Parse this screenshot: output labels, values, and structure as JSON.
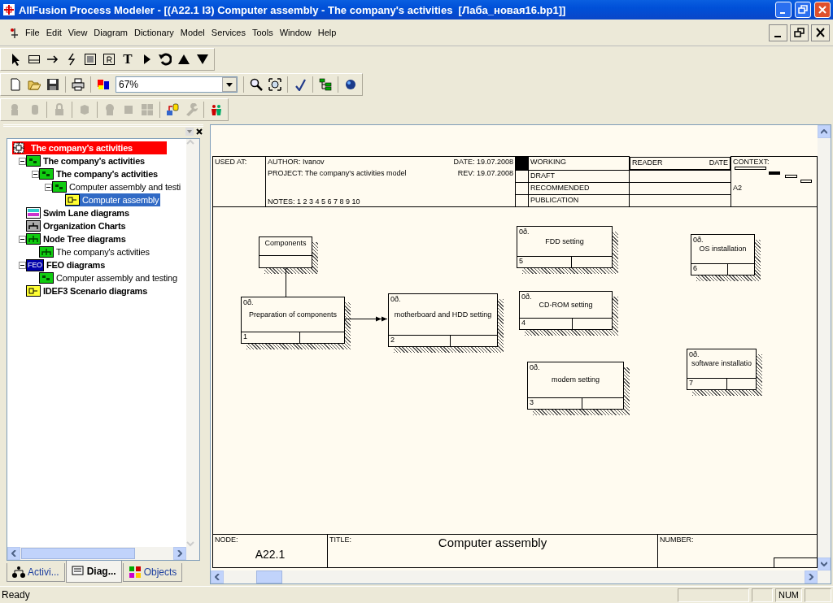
{
  "window": {
    "title": "AllFusion Process Modeler - [(A22.1 I3) Computer assembly - The company's activities  [Лаба_новая16.bp1]]"
  },
  "menu": [
    "File",
    "Edit",
    "View",
    "Diagram",
    "Dictionary",
    "Model",
    "Services",
    "Tools",
    "Window",
    "Help"
  ],
  "toolbar": {
    "text_tool": "T",
    "zoom": "67%"
  },
  "tree": {
    "items": [
      {
        "label": "The company's activities",
        "kind": "model",
        "bold": true,
        "selected": false,
        "children": [
          {
            "label": "The company's activities",
            "kind": "idef0",
            "bold": true,
            "selected": false,
            "expanded": true,
            "children": [
              {
                "label": "The company's activities",
                "kind": "idef0",
                "bold": true,
                "selected": false,
                "expanded": true,
                "children": [
                  {
                    "label": "Computer assembly and testi",
                    "kind": "idef0",
                    "bold": false,
                    "selected": false,
                    "expanded": true,
                    "children": [
                      {
                        "label": "Computer assembly",
                        "kind": "idef3",
                        "bold": false,
                        "selected": true
                      }
                    ]
                  }
                ]
              }
            ]
          },
          {
            "label": "Swim Lane diagrams",
            "kind": "swimlane",
            "bold": true,
            "selected": false
          },
          {
            "label": "Organization Charts",
            "kind": "org",
            "bold": true,
            "selected": false
          },
          {
            "label": "Node Tree diagrams",
            "kind": "nodetree",
            "bold": true,
            "selected": false,
            "expanded": true,
            "children": [
              {
                "label": "The company's activities",
                "kind": "nodetree",
                "bold": false,
                "selected": false
              }
            ]
          },
          {
            "label": "FEO diagrams",
            "kind": "feo",
            "icon_text": "FEO",
            "bold": true,
            "selected": false,
            "expanded": true,
            "children": [
              {
                "label": "Computer assembly and testing",
                "kind": "idef0",
                "bold": false,
                "selected": false
              }
            ]
          },
          {
            "label": "IDEF3 Scenario diagrams",
            "kind": "idef3",
            "bold": true,
            "selected": false
          }
        ]
      }
    ]
  },
  "panel_tabs": [
    {
      "label": "Activi...",
      "kind": "activities",
      "selected": false
    },
    {
      "label": "Diag...",
      "kind": "diagrams",
      "selected": true
    },
    {
      "label": "Objects",
      "kind": "objects",
      "selected": false
    }
  ],
  "form": {
    "used_at": "USED AT:",
    "author": "AUTHOR:  Ivanov",
    "project": "PROJECT:  The company's activities model",
    "date": "DATE: 19.07.2008",
    "rev": "REV:   19.07.2008",
    "notes": "NOTES:  1  2  3  4  5  6  7  8  9  10",
    "statuses": [
      {
        "label": "WORKING",
        "selected": true
      },
      {
        "label": "DRAFT",
        "selected": false
      },
      {
        "label": "RECOMMENDED",
        "selected": false
      },
      {
        "label": "PUBLICATION",
        "selected": false
      }
    ],
    "reader": "READER",
    "reader_date": "DATE",
    "context": "CONTEXT:",
    "context_node": "A2",
    "node_label": "NODE:",
    "node": "A22.1",
    "title_label": "TITLE:",
    "title": "Computer assembly",
    "number_label": "NUMBER:"
  },
  "boxes": [
    {
      "kind": "referent",
      "label": "Components"
    },
    {
      "kind": "unit",
      "label": "Preparation of components",
      "number": "1",
      "cost": "0ð."
    },
    {
      "kind": "unit",
      "label": "motherboard and HDD setting",
      "number": "2",
      "cost": "0ð."
    },
    {
      "kind": "unit",
      "label": "FDD setting",
      "number": "5",
      "cost": "0ð."
    },
    {
      "kind": "unit",
      "label": "CD-ROM setting",
      "number": "4",
      "cost": "0ð."
    },
    {
      "kind": "unit",
      "label": "modem setting",
      "number": "3",
      "cost": "0ð."
    },
    {
      "kind": "unit",
      "label": "OS installation",
      "number": "6",
      "cost": "0ð."
    },
    {
      "kind": "unit",
      "label": "software installatio",
      "number": "7",
      "cost": "0ð."
    }
  ],
  "status_bar": {
    "message": "Ready",
    "num": "NUM"
  }
}
